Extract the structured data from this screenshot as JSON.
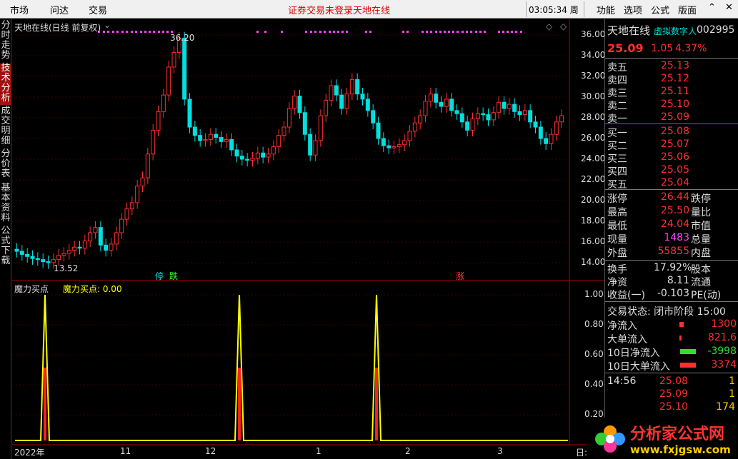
{
  "topbar": {
    "market": "市场",
    "wenda": "问达",
    "trade": "交易",
    "login_notice": "证券交易未登录",
    "brand": "天地在线",
    "time": "03:05:34 周四",
    "menu": [
      "功能",
      "选项",
      "公式",
      "版面"
    ]
  },
  "leftbar": {
    "tabs": [
      "分时走势",
      "技术分析",
      "成交明细",
      "分价表",
      "基本资料",
      "公式下载"
    ],
    "active": 1
  },
  "chart": {
    "title": "天地在线(日线 前复权)",
    "high_label": "36.20",
    "low_label": "13.52",
    "y_labels": [
      "36.00",
      "34.00",
      "32.00",
      "30.00",
      "28.00",
      "26.00",
      "24.00",
      "22.00",
      "20.00",
      "18.00",
      "16.00",
      "14.00"
    ],
    "markers": [
      "停",
      "跌",
      "涨"
    ]
  },
  "indicator": {
    "name": "魔力买点",
    "value_text": "魔力买点: 0.00",
    "y_labels": [
      "1.00",
      "0.80",
      "0.60",
      "0.40",
      "0.20"
    ]
  },
  "xaxis": {
    "labels": [
      "2022年",
      "11",
      "12",
      "1",
      "2",
      "3"
    ],
    "corner": "日:"
  },
  "quote": {
    "name": "天地在线",
    "tag": "虚拟数字人",
    "code": "002995",
    "price": "25.09",
    "change": "1.05",
    "pct": "4.37%",
    "asks": [
      [
        "卖五",
        "25.13"
      ],
      [
        "卖四",
        "25.12"
      ],
      [
        "卖三",
        "25.11"
      ],
      [
        "卖二",
        "25.10"
      ],
      [
        "卖一",
        "25.09"
      ]
    ],
    "bids": [
      [
        "买一",
        "25.08"
      ],
      [
        "买二",
        "25.07"
      ],
      [
        "买三",
        "25.06"
      ],
      [
        "买四",
        "25.05"
      ],
      [
        "买五",
        "25.04"
      ]
    ],
    "stats": [
      [
        "涨停",
        "26.44",
        "跌停"
      ],
      [
        "最高",
        "25.50",
        "量比"
      ],
      [
        "最低",
        "24.04",
        "市值"
      ],
      [
        "现量",
        "1483",
        "总量"
      ],
      [
        "外盘",
        "55855",
        "内盘"
      ]
    ],
    "stats2": [
      [
        "换手",
        "17.92%",
        "股本"
      ],
      [
        "净资",
        "8.11",
        "流通"
      ],
      [
        "收益(一)",
        "-0.103",
        "PE(动)"
      ]
    ],
    "status": "交易状态: 闭市阶段 15:00",
    "flows": [
      [
        "净流入",
        "1300"
      ],
      [
        "大单流入",
        "821.6"
      ],
      [
        "10日净流入",
        "-3998"
      ],
      [
        "10日大单流入",
        "3374"
      ]
    ],
    "ticks": [
      [
        "14:56",
        "25.08",
        "1"
      ],
      [
        "",
        "25.09",
        "1"
      ],
      [
        "",
        "25.10",
        "174"
      ]
    ]
  },
  "logo": {
    "cn": "分析家公式网",
    "url": "www.fxjgsw.com"
  },
  "colors": {
    "up": "#ff3030",
    "down": "#00e0e0",
    "yellow": "#ffff00",
    "magenta": "#ff40ff"
  }
}
